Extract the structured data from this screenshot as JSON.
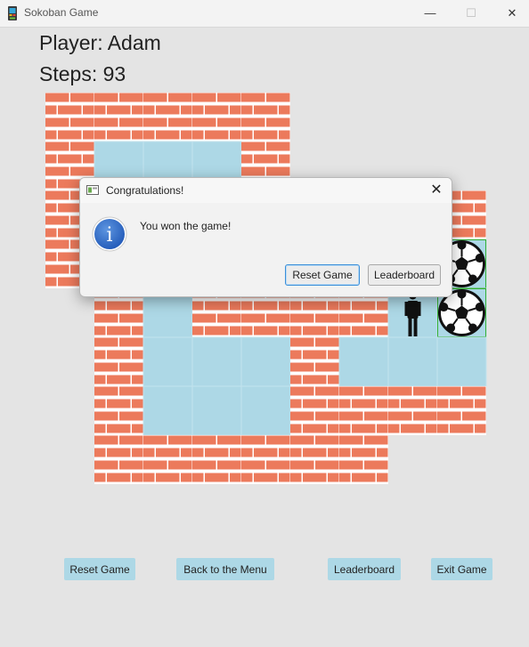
{
  "window": {
    "title": "Sokoban Game",
    "minimize_glyph": "—",
    "maximize_glyph": "☐",
    "close_glyph": "✕"
  },
  "game": {
    "player_label": "Player: Adam",
    "steps_label": "Steps: 93"
  },
  "board": {
    "rows": 9,
    "cols": 9,
    "legend": {
      "#": "brick wall",
      ".": "floor",
      "B": "ball on goal",
      "P": "player",
      "_": "empty"
    },
    "map": [
      "#####____",
      "#...#____",
      "#...#####",
      "##.#####B",
      "_#.####PB",
      "_#...#...",
      "_#...####",
      "_######__",
      "_________"
    ],
    "colors": {
      "brick": "#ec7a5c",
      "mortar": "#ffffff",
      "floor": "#add8e6",
      "goal_border": "#34b034",
      "background": "#e4e4e4"
    }
  },
  "controls": {
    "reset": "Reset Game",
    "menu": "Back to the Menu",
    "leaderboard": "Leaderboard",
    "exit": "Exit Game"
  },
  "dialog": {
    "title": "Congratulations!",
    "message": "You won the game!",
    "reset_button": "Reset Game",
    "leaderboard_button": "Leaderboard",
    "close_glyph": "✕",
    "info_glyph": "i"
  }
}
